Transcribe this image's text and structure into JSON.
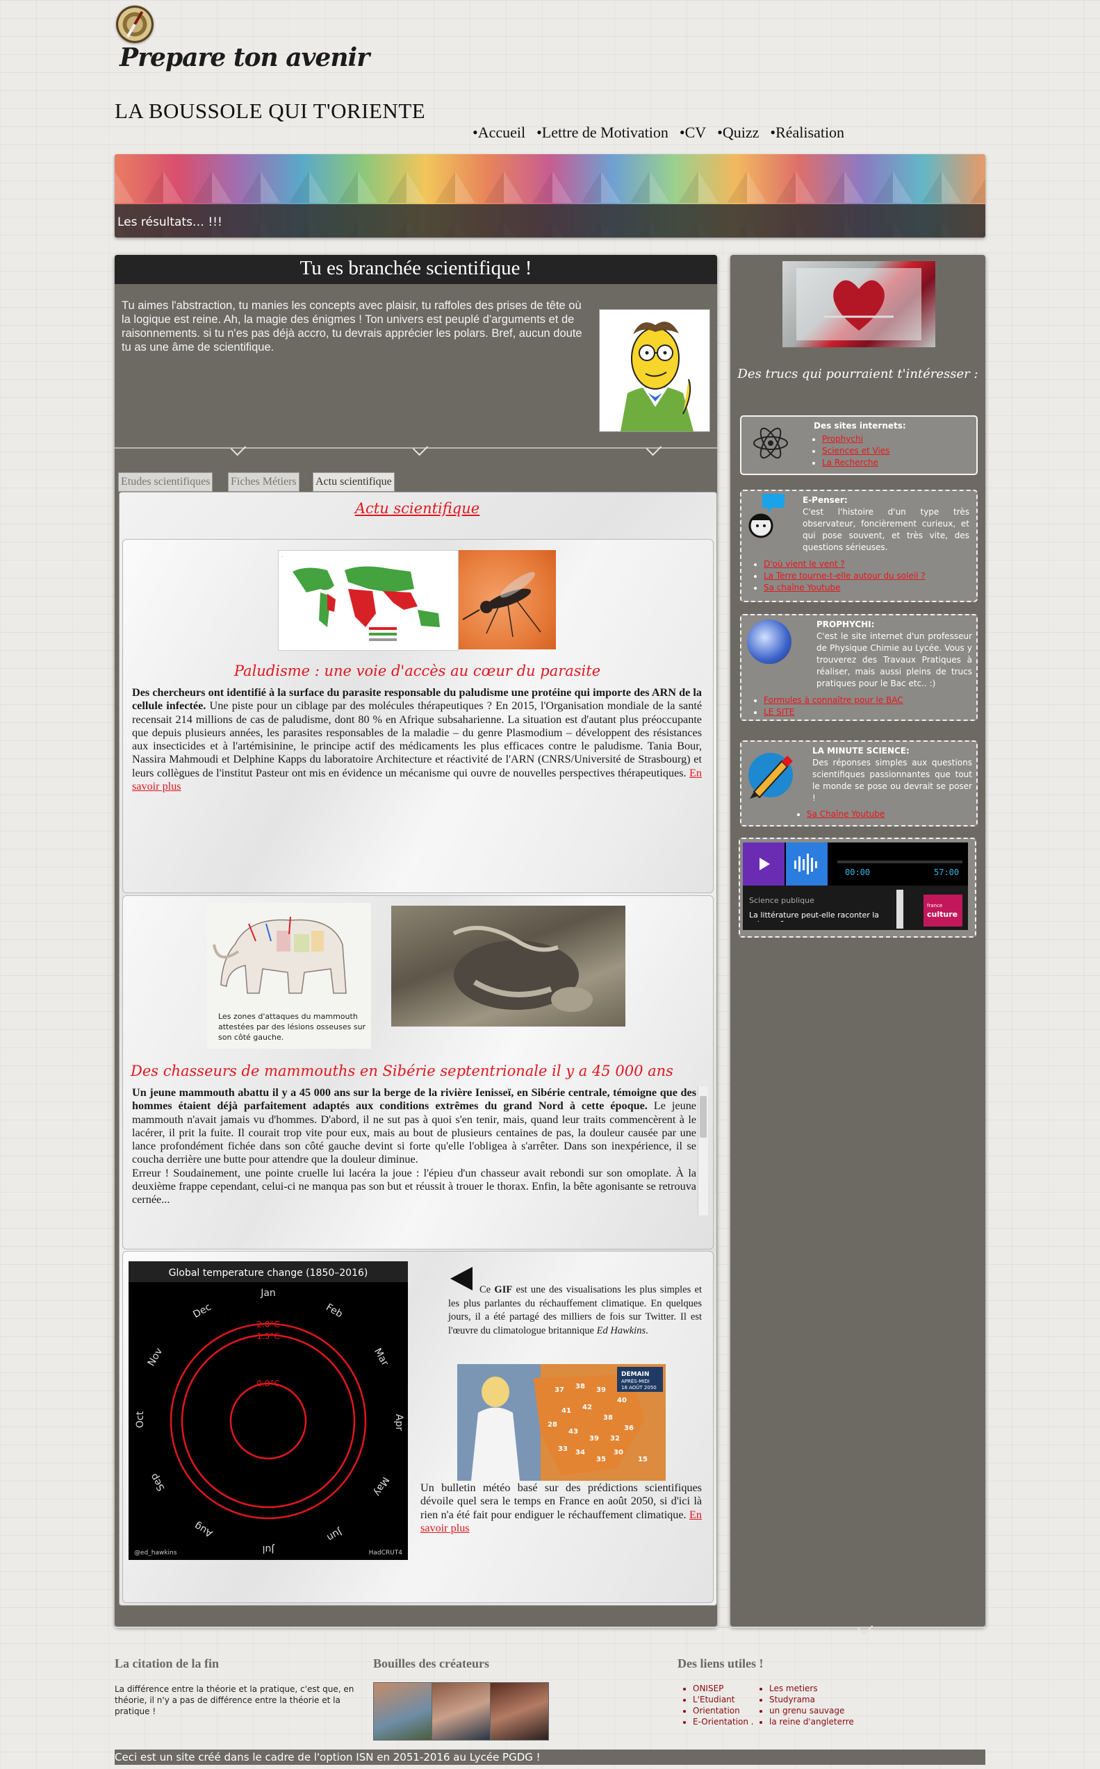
{
  "header": {
    "tagline": "Prepare ton avenir",
    "brand": "LA BOUSSOLE QUI T'ORIENTE",
    "nav": [
      "•Accueil",
      "•Lettre de Motivation",
      "•CV",
      "•Quizz",
      "•Réalisation"
    ]
  },
  "banner": {
    "caption": "Les résultats… !!!"
  },
  "main": {
    "title": "Tu es branchée scientifique !",
    "intro": "Tu aimes l'abstraction, tu manies les concepts avec plaisir, tu raffoles des prises de tête où la logique est reine. Ah, la magie des énigmes ! Ton univers est peuplé d'arguments et de raisonnements. si tu n'es pas déjà accro, tu devrais apprécier les polars. Bref, aucun doute tu as une âme de scientifique.",
    "tabs": [
      "Etudes scientifiques",
      "Fiches Métiers",
      "Actu scientifique"
    ],
    "active_tab_title": "Actu scientifique"
  },
  "articles": [
    {
      "title": "Paludisme : une voie d'accès au cœur du parasite",
      "lead": "Des chercheurs ont identifié à la surface du parasite responsable du paludisme une protéine qui importe des ARN de la cellule infectée.",
      "body": " Une piste pour un ciblage par des molécules thérapeutiques ? En 2015, l'Organisation mondiale de la santé recensait 214 millions de cas de paludisme, dont 80 % en Afrique subsaharienne. La situation est d'autant plus préoccupante que depuis plusieurs années, les parasites responsables de la maladie – du genre Plasmodium – développent des résistances aux insecticides et à l'artémisinine, le principe actif des médicaments les plus efficaces contre le paludisme. Tania Bour, Nassira Mahmoudi et Delphine Kapps du laboratoire Architecture et réactivité de l'ARN (CNRS/Université de Strasbourg) et leurs collègues de l'institut Pasteur ont mis en évidence un mécanisme qui ouvre de nouvelles perspectives thérapeutiques. ",
      "link": "En savoir plus"
    },
    {
      "title": "Des chasseurs de mammouths en Sibérie septentrionale il y a 45 000 ans",
      "image_caption": "Les zones d'attaques du mammouth attestées par des lésions osseuses sur son côté gauche.",
      "lead": "Un jeune mammouth abattu il y a 45 000 ans sur la berge de la rivière Ienisseï, en Sibérie centrale, témoigne que des hommes étaient déjà parfaitement adaptés aux conditions extrêmes du grand Nord à cette époque.",
      "body": " Le jeune mammouth n'avait jamais vu d'hommes. D'abord, il ne sut pas à quoi s'en tenir, mais, quand leur traits commencèrent à le lacérer, il prit la fuite. Il courait trop vite pour eux, mais au bout de plusieurs centaines de pas, la douleur causée par une lance profondément fichée dans son côté gauche devint si forte qu'elle l'obligea à s'arrêter. Dans son inexpérience, il se coucha derrière une butte pour attendre que la douleur diminue.",
      "body2": "Erreur ! Soudainement, une pointe cruelle lui lacéra la joue : l'épieu d'un chasseur avait rebondi sur son omoplate. À la deuxième frappe cependant, celui-ci ne manqua pas son but et réussit à trouer le thorax. Enfin, la bête agonisante se retrouva cernée..."
    },
    {
      "gif_title": "Global temperature change (1850–2016)",
      "months": [
        "Jan",
        "Feb",
        "Mar",
        "Apr",
        "May",
        "Jun",
        "Jul",
        "Aug",
        "Sep",
        "Oct",
        "Nov",
        "Dec"
      ],
      "rings": [
        "2.0°C",
        "1.5°C",
        "0.0°C"
      ],
      "gif_credit_left": "@ed_hawkins",
      "gif_credit_right": "HadCRUT4",
      "gif_text_1": "Ce ",
      "gif_text_bold": "GIF",
      "gif_text_2": " est une des visualisations les plus simples et les plus parlantes du réchauffement climatique. En quelques jours, il a été partagé des milliers de fois sur Twitter. Il est l'œuvre du climatologue britannique ",
      "gif_text_author": "Ed Hawkins",
      "gif_text_end": ".",
      "meteo_text": "Un bulletin météo basé sur des prédictions scientifiques dévoile quel sera le temps en France en août 2050, si d'ici là rien n'a été fait pour endiguer le réchauffement climatique. ",
      "link": "En savoir plus",
      "meteo_label_1": "DEMAIN",
      "meteo_label_2": "APRÈS-MIDI",
      "meteo_label_3": "18 AOÛT 2050",
      "meteo_temps": [
        "37",
        "38",
        "39",
        "40",
        "41",
        "42",
        "38",
        "43",
        "39",
        "28",
        "32",
        "34",
        "35",
        "36",
        "33",
        "15",
        "30"
      ]
    }
  ],
  "sidebar": {
    "title": "Des trucs qui pourraient t'intéresser :",
    "boxes": [
      {
        "head": "Des sites internets:",
        "links": [
          "Prophychi",
          "Sciences et Vies",
          "La Recherche"
        ]
      },
      {
        "head": "E-Penser:",
        "text": "C'est l'histoire d'un type très observateur, foncièrement curieux, et qui pose souvent, et très vite, des questions sérieuses.",
        "links": [
          "D'où vient le vent ?",
          "La Terre tourne-t-elle autour du soleil ?",
          "Sa chaîne Youtube"
        ]
      },
      {
        "head": "PROPHYCHI:",
        "text": "C'est le site internet d'un professeur de Physique Chimie au Lycée. Vous y trouverez des Travaux Pratiques à réaliser, mais aussi pleins de trucs pratiques pour le Bac etc.. :)",
        "links": [
          "Formules à connaître pour le BAC",
          "LE SITE"
        ]
      },
      {
        "head": "LA MINUTE SCIENCE:",
        "text": "Des réponses simples aux questions scientifiques passionnantes que tout le monde se pose ou devrait se poser !",
        "links": [
          "Sa Chaîne Youtube"
        ]
      }
    ],
    "player": {
      "time_start": "00:00",
      "time_end": "57:00",
      "show": "Science publique",
      "episode": "La littérature peut-elle raconter la science ?",
      "brand_top": "france",
      "brand": "culture"
    }
  },
  "footer": {
    "quote_title": "La citation de la fin",
    "quote": "La différence entre la théorie et la pratique, c'est que, en théorie, il n'y a pas de différence entre la théorie et la pratique !",
    "creators_title": "Bouilles des créateurs",
    "links_title": "Des liens utiles !",
    "links_col1": [
      "ONISEP",
      "L'Etudiant",
      "Orientation",
      "E-Orientation ."
    ],
    "links_col2": [
      "Les metiers",
      "Studyrama",
      "un grenu sauvage",
      "la reine d'angleterre"
    ],
    "bottom": "Ceci est un site créé dans le cadre de l'option ISN en 2051-2016 au Lycée PGDG !"
  },
  "colors": {
    "accent_red": "#e2161e",
    "panel": "#6d6a63",
    "header_dark": "#242424"
  }
}
